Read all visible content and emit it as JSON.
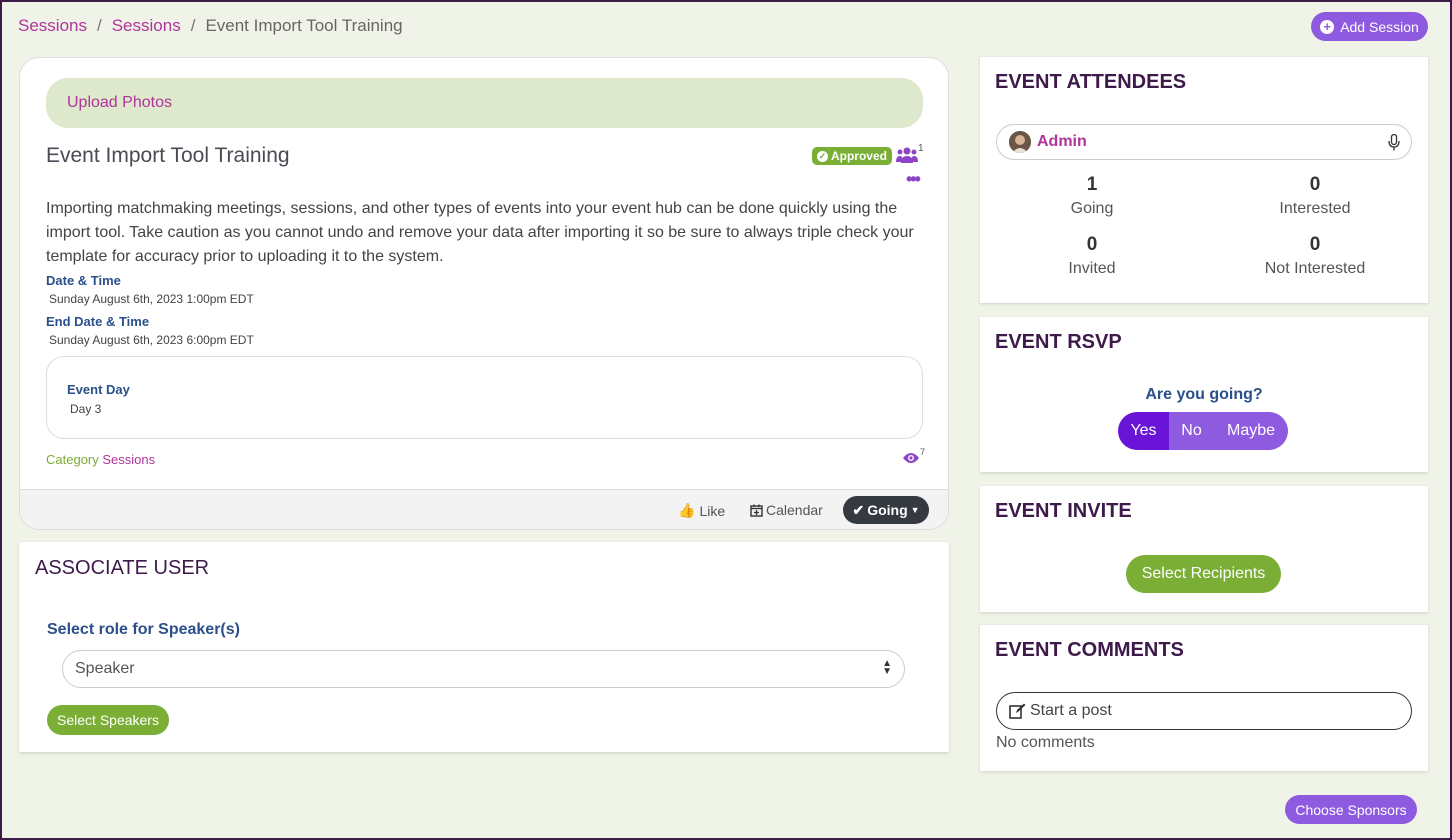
{
  "breadcrumb": {
    "item1": "Sessions",
    "item2": "Sessions",
    "current": "Event Import Tool Training",
    "separator": "/"
  },
  "header": {
    "add_session": "Add Session"
  },
  "event": {
    "upload_photos": "Upload Photos",
    "title": "Event Import Tool Training",
    "status": "Approved",
    "attendee_count": "1",
    "description": "Importing matchmaking meetings, sessions, and other types of events into your event hub can be done quickly using the import tool. Take caution as you cannot undo and remove your data after importing it so be sure to always triple check your template for accuracy prior to uploading it to the system.",
    "date_label": "Date & Time",
    "date_value": "Sunday August 6th, 2023 1:00pm EDT",
    "end_date_label": "End Date & Time",
    "end_date_value": "Sunday August 6th, 2023 6:00pm EDT",
    "event_day_label": "Event Day",
    "event_day_value": "Day 3",
    "category_label": "Category",
    "category_value": "Sessions",
    "view_count": "7",
    "like_label": "Like",
    "calendar_label": "Calendar",
    "going_label": "Going"
  },
  "associate": {
    "title": "ASSOCIATE USER",
    "role_label": "Select role for Speaker(s)",
    "role_selected": "Speaker",
    "button": "Select Speakers"
  },
  "attendees": {
    "title": "EVENT ATTENDEES",
    "admin_name": "Admin",
    "going_num": "1",
    "going_label": "Going",
    "interested_num": "0",
    "interested_label": "Interested",
    "invited_num": "0",
    "invited_label": "Invited",
    "not_interested_num": "0",
    "not_interested_label": "Not Interested"
  },
  "rsvp": {
    "title": "EVENT RSVP",
    "question": "Are you going?",
    "yes": "Yes",
    "no": "No",
    "maybe": "Maybe",
    "selected": "Yes"
  },
  "invite": {
    "title": "EVENT INVITE",
    "button": "Select Recipients"
  },
  "comments": {
    "title": "EVENT COMMENTS",
    "placeholder": "Start a post",
    "empty": "No comments"
  },
  "footer": {
    "sponsors": "Choose Sponsors"
  },
  "colors": {
    "accent_purple": "#8e5be0",
    "active_purple": "#6a14d8",
    "green": "#7aae35",
    "magenta": "#b0349a",
    "navy": "#3d1a4a"
  }
}
